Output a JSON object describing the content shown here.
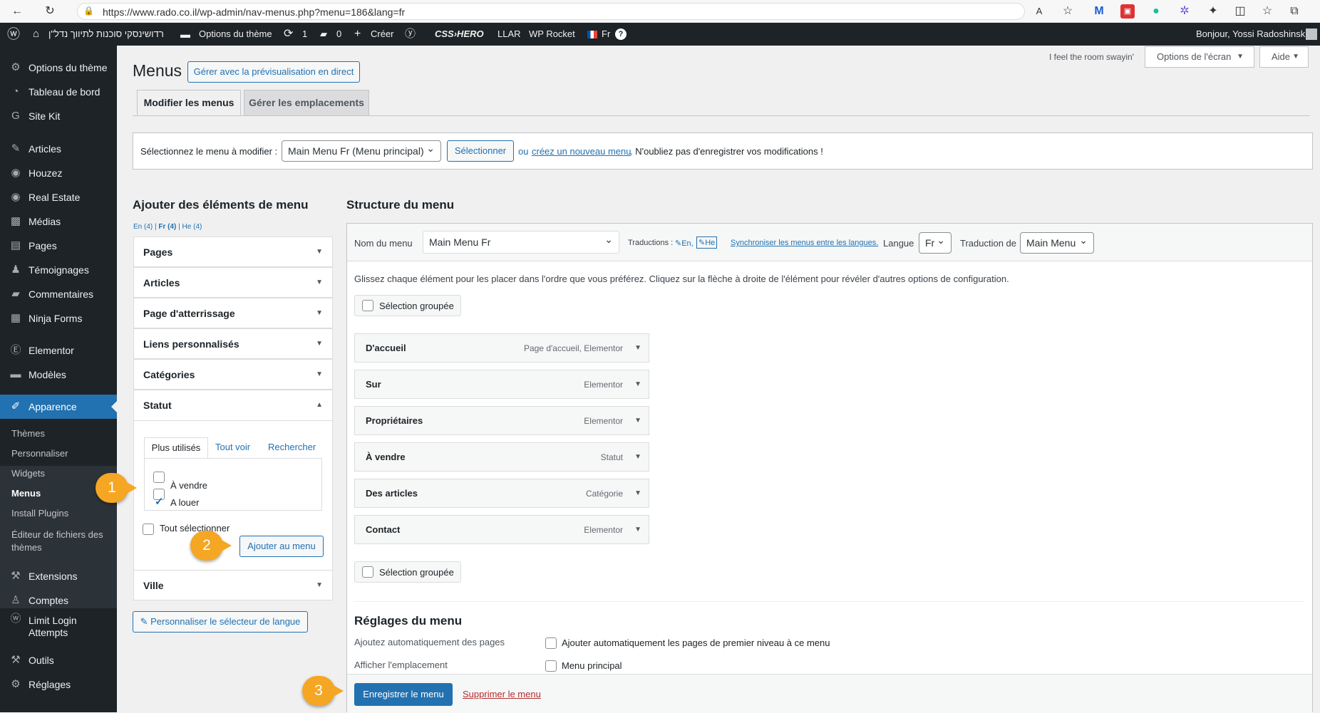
{
  "browser": {
    "url": "https://www.rado.co.il/wp-admin/nav-menus.php?menu=186&lang=fr"
  },
  "adminbar": {
    "site_name": "רדושינסקי סוכנות לתיווך נדל\"ן",
    "theme_options": "Options du thème",
    "updates_count": "1",
    "comments_count": "0",
    "new_label": "Créer",
    "css_hero": "CSS›HERO",
    "llar": "LLAR",
    "wp_rocket": "WP Rocket",
    "lang": "Fr",
    "greeting": "Bonjour, Yossi Radoshinski"
  },
  "sidebar": {
    "items": [
      {
        "label": "Options du thème",
        "icon": "gear-icon"
      },
      {
        "label": "Tableau de bord",
        "icon": "dashboard-icon"
      },
      {
        "label": "Site Kit",
        "icon": "google-g-icon"
      },
      {
        "label": "Articles",
        "icon": "pin-icon"
      },
      {
        "label": "Houzez",
        "icon": "circle-icon"
      },
      {
        "label": "Real Estate",
        "icon": "circle-icon"
      },
      {
        "label": "Médias",
        "icon": "media-icon"
      },
      {
        "label": "Pages",
        "icon": "pages-icon"
      },
      {
        "label": "Témoignages",
        "icon": "person-icon"
      },
      {
        "label": "Commentaires",
        "icon": "comment-icon"
      },
      {
        "label": "Ninja Forms",
        "icon": "form-icon"
      },
      {
        "label": "Elementor",
        "icon": "elementor-icon"
      },
      {
        "label": "Modèles",
        "icon": "folder-icon"
      },
      {
        "label": "Apparence",
        "icon": "brush-icon"
      },
      {
        "label": "Extensions",
        "icon": "plug-icon"
      },
      {
        "label": "Comptes",
        "icon": "user-icon"
      },
      {
        "label": "Limit Login Attempts",
        "icon": "wp-icon"
      },
      {
        "label": "Outils",
        "icon": "wrench-icon"
      },
      {
        "label": "Réglages",
        "icon": "settings-icon"
      }
    ],
    "submenu": [
      "Thèmes",
      "Personnaliser",
      "Widgets",
      "Menus",
      "Install Plugins",
      "Éditeur de fichiers des thèmes"
    ]
  },
  "header": {
    "title": "Menus",
    "live_preview": "Gérer avec la prévisualisation en direct",
    "room_text": "I feel the room swayin'",
    "screen_options": "Options de l'écran",
    "help": "Aide"
  },
  "tabs": [
    "Modifier les menus",
    "Gérer les emplacements"
  ],
  "select_bar": {
    "label": "Sélectionnez le menu à modifier :",
    "selected": "Main Menu Fr (Menu principal)",
    "select_btn": "Sélectionner",
    "or_text": "ou",
    "create_link": "créez un nouveau menu",
    "reminder": ". N'oubliez pas d'enregistrer vos modifications !"
  },
  "add_items": {
    "title": "Ajouter des éléments de menu",
    "lang_en": "En (4)",
    "lang_fr": "Fr (4)",
    "lang_he": "He (4)",
    "sections": [
      "Pages",
      "Articles",
      "Page d'atterrissage",
      "Liens personnalisés",
      "Catégories",
      "Statut",
      "Ville"
    ],
    "statut_tabs": [
      "Plus utilisés",
      "Tout voir",
      "Rechercher"
    ],
    "options": [
      {
        "label": "À vendre",
        "checked": false
      },
      {
        "label": "A louer",
        "checked": true
      }
    ],
    "select_all": "Tout sélectionner",
    "add_btn": "Ajouter au menu",
    "customize_lang": "Personnaliser le sélecteur de langue"
  },
  "structure": {
    "title": "Structure du menu",
    "name_label": "Nom du menu",
    "name_value": "Main Menu Fr",
    "translations_label": "Traductions :",
    "trans_en": "En",
    "trans_he": "He",
    "sync_link": "Synchroniser les menus entre les langues.",
    "lang_label": "Langue",
    "lang_value": "Fr",
    "translation_of_label": "Traduction de",
    "translation_of_value": "Main Menu",
    "instructions": "Glissez chaque élément pour les placer dans l'ordre que vous préférez. Cliquez sur la flèche à droite de l'élément pour révéler d'autres options de configuration.",
    "bulk_select": "Sélection groupée",
    "items": [
      {
        "title": "D'accueil",
        "type": "Page d'accueil, Elementor"
      },
      {
        "title": "Sur",
        "type": "Elementor"
      },
      {
        "title": "Propriétaires",
        "type": "Elementor"
      },
      {
        "title": "À vendre",
        "type": "Statut"
      },
      {
        "title": "Des articles",
        "type": "Catégorie"
      },
      {
        "title": "Contact",
        "type": "Elementor"
      }
    ],
    "settings_title": "Réglages du menu",
    "auto_add_label": "Ajoutez automatiquement des pages",
    "auto_add_option": "Ajouter automatiquement les pages de premier niveau à ce menu",
    "location_label": "Afficher l'emplacement",
    "location_option": "Menu principal",
    "save_btn": "Enregistrer le menu",
    "delete_link": "Supprimer le menu"
  },
  "annotations": [
    "1",
    "2",
    "3"
  ],
  "colors": {
    "accent": "#2271b1",
    "adminbar": "#1d2327",
    "badge": "#f5a623",
    "delete": "#b32d2e"
  }
}
